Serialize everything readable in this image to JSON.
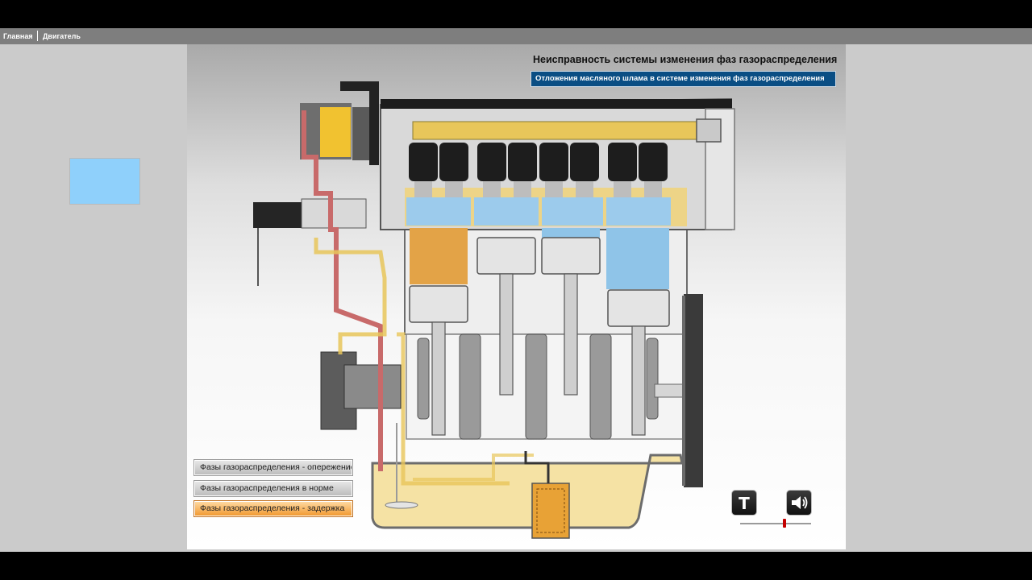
{
  "nav": {
    "home": "Главная",
    "engine": "Двигатель"
  },
  "stage": {
    "title": "Неисправность системы изменения фаз газораспределения",
    "subtitle": "Отложения масляного шлама в системе изменения фаз газораспределения"
  },
  "mode_buttons": [
    {
      "label": "Фазы газораспределения - опережение",
      "style": "gray"
    },
    {
      "label": "Фазы газораспределения в норме",
      "style": "gray"
    },
    {
      "label": "Фазы газораспределения - задержка",
      "style": "orange"
    }
  ],
  "controls": {
    "text_button_glyph": "T",
    "sound_icon": "speaker-icon",
    "volume_fraction": 0.62
  },
  "colors": {
    "oil": "#e8c65a",
    "oil_light": "#f3dd8e",
    "oil_line_red": "#c86a6a",
    "coolant_blue": "#8fc4e8",
    "engine_gray": "#8a8a8a",
    "subtitle_bg": "#0a4e84",
    "nav_bg": "#7e7e7e"
  }
}
